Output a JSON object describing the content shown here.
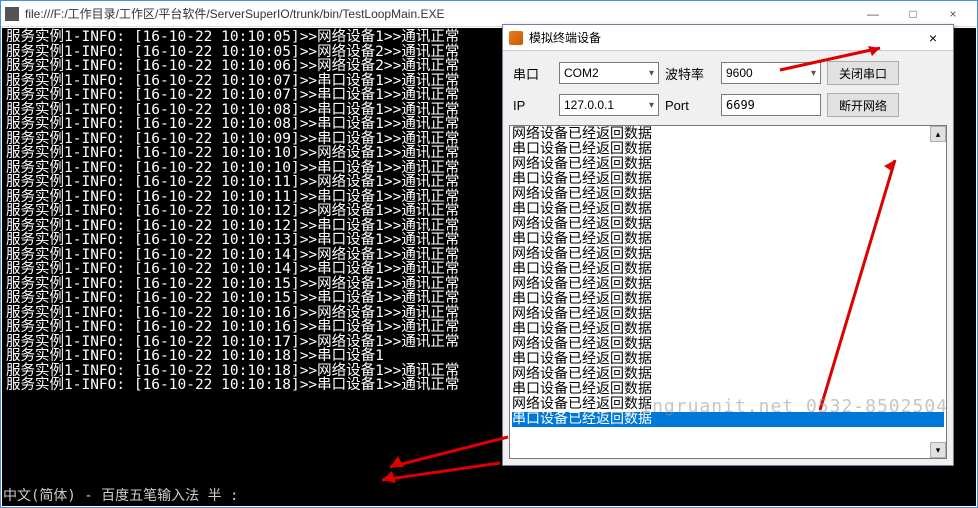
{
  "main_title": "file:///F:/工作目录/工作区/平台软件/ServerSuperIO/trunk/bin/TestLoopMain.EXE",
  "win_min": "—",
  "win_max": "□",
  "win_close": "×",
  "console_lines": [
    "服务实例1-INFO: [16-10-22 10:10:05]>>网络设备1>>通讯正常",
    "服务实例1-INFO: [16-10-22 10:10:05]>>网络设备2>>通讯正常",
    "服务实例1-INFO: [16-10-22 10:10:06]>>网络设备2>>通讯正常",
    "服务实例1-INFO: [16-10-22 10:10:07]>>串口设备1>>通讯正常",
    "服务实例1-INFO: [16-10-22 10:10:07]>>串口设备1>>通讯正常",
    "服务实例1-INFO: [16-10-22 10:10:08]>>串口设备1>>通讯正常",
    "服务实例1-INFO: [16-10-22 10:10:08]>>串口设备1>>通讯正常",
    "服务实例1-INFO: [16-10-22 10:10:09]>>串口设备1>>通讯正常",
    "服务实例1-INFO: [16-10-22 10:10:10]>>网络设备1>>通讯正常",
    "服务实例1-INFO: [16-10-22 10:10:10]>>串口设备1>>通讯正常",
    "服务实例1-INFO: [16-10-22 10:10:11]>>网络设备1>>通讯正常",
    "服务实例1-INFO: [16-10-22 10:10:11]>>串口设备1>>通讯正常",
    "服务实例1-INFO: [16-10-22 10:10:12]>>网络设备1>>通讯正常",
    "服务实例1-INFO: [16-10-22 10:10:12]>>串口设备1>>通讯正常",
    "服务实例1-INFO: [16-10-22 10:10:13]>>串口设备1>>通讯正常",
    "服务实例1-INFO: [16-10-22 10:10:14]>>网络设备1>>通讯正常",
    "服务实例1-INFO: [16-10-22 10:10:14]>>串口设备1>>通讯正常",
    "服务实例1-INFO: [16-10-22 10:10:15]>>网络设备1>>通讯正常",
    "服务实例1-INFO: [16-10-22 10:10:15]>>串口设备1>>通讯正常",
    "服务实例1-INFO: [16-10-22 10:10:16]>>网络设备1>>通讯正常",
    "服务实例1-INFO: [16-10-22 10:10:16]>>串口设备1>>通讯正常",
    "服务实例1-INFO: [16-10-22 10:10:17]>>网络设备1>>通讯正常",
    "服务实例1-INFO: [16-10-22 10:10:18]>>串口设备1",
    "服务实例1-INFO: [16-10-22 10:10:18]>>网络设备1>>通讯正常",
    "服务实例1-INFO: [16-10-22 10:10:18]>>串口设备1>>通讯正常"
  ],
  "ime_text": "中文(简体) - 百度五笔输入法 半 :",
  "dialog": {
    "title": "模拟终端设备",
    "close": "×",
    "serial_label": "串口",
    "serial_value": "COM2",
    "baud_label": "波特率",
    "baud_value": "9600",
    "close_serial_btn": "关闭串口",
    "ip_label": "IP",
    "ip_value": "127.0.0.1",
    "port_label": "Port",
    "port_value": "6699",
    "disconnect_btn": "断开网络",
    "list_items": [
      "网络设备已经返回数据",
      "串口设备已经返回数据",
      "网络设备已经返回数据",
      "串口设备已经返回数据",
      "网络设备已经返回数据",
      "串口设备已经返回数据",
      "网络设备已经返回数据",
      "串口设备已经返回数据",
      "网络设备已经返回数据",
      "串口设备已经返回数据",
      "网络设备已经返回数据",
      "串口设备已经返回数据",
      "网络设备已经返回数据",
      "串口设备已经返回数据",
      "网络设备已经返回数据",
      "串口设备已经返回数据",
      "网络设备已经返回数据",
      "串口设备已经返回数据",
      "网络设备已经返回数据",
      "串口设备已经返回数据"
    ],
    "selected_index": 19,
    "scroll_up": "▴",
    "scroll_down": "▾"
  },
  "watermark": "ingruanit.net 0532-8502504"
}
